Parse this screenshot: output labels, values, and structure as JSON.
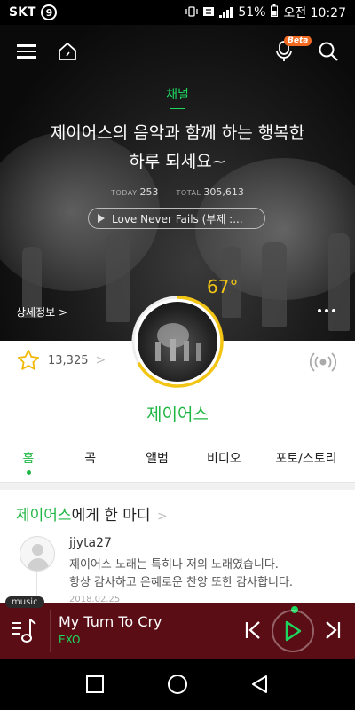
{
  "status_bar": {
    "carrier": "SKT",
    "carrier_badge": "9",
    "battery": "51%",
    "time": "오전 10:27"
  },
  "header": {
    "menu_icon": "hamburger-icon",
    "home_icon": "home-icon",
    "voice_icon": "microphone-icon",
    "beta_label": "Beta",
    "search_icon": "search-icon"
  },
  "hero": {
    "channel_label": "채널",
    "headline_line1": "제이어스의 음악과 함께 하는 행복한",
    "headline_line2": "하루 되세요~",
    "today_label": "TODAY",
    "today_value": "253",
    "total_label": "TOTAL",
    "total_value": "305,613",
    "featured_song": "Love Never Fails (부제 :...",
    "temperature": "67°",
    "temperature_fraction": 0.67,
    "details_link": "상세정보 >"
  },
  "artist": {
    "name": "제이어스",
    "fan_count": "13,325",
    "fan_arrow": ">"
  },
  "tabs": [
    {
      "label": "홈"
    },
    {
      "label": "곡"
    },
    {
      "label": "앨범"
    },
    {
      "label": "비디오"
    },
    {
      "label": "포토/스토리"
    }
  ],
  "comments": {
    "title_artist": "제이어스",
    "title_rest": "에게 한 마디",
    "chevron": ">",
    "items": [
      {
        "user": "jjyta27",
        "line1": "제이어스 노래는 특히나 저의 노래였습니다.",
        "line2": "항상 감사하고 은혜로운 찬양 또한 감사합니다.",
        "date": "2018.02.25"
      }
    ]
  },
  "player": {
    "tag": "music",
    "title": "My Turn To Cry",
    "artist": "EXO"
  },
  "colors": {
    "accent_green": "#1fb744",
    "player_bg": "#5a0d14",
    "temperature_yellow": "#f2c515",
    "beta_orange": "#f26a21"
  }
}
